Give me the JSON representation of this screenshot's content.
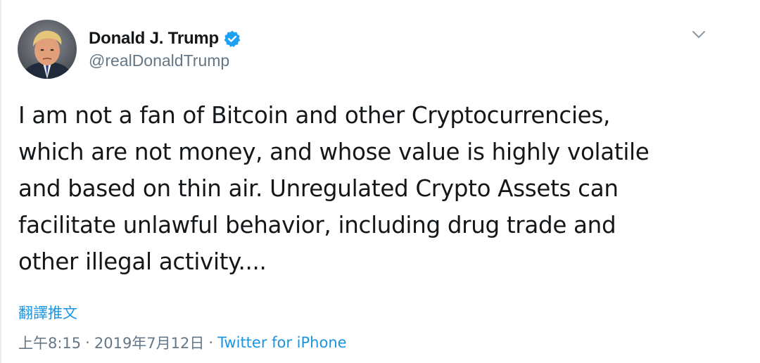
{
  "tweet": {
    "display_name": "Donald J. Trump",
    "handle": "@realDonaldTrump",
    "verified": true,
    "text": "I am not a fan of Bitcoin and other Cryptocurrencies,\nwhich are not money, and whose value is highly volatile\nand based on thin air. Unregulated Crypto Assets can\nfacilitate unlawful behavior, including drug trade and\nother illegal activity....",
    "translate_label": "翻譯推文",
    "time": "上午8:15",
    "separator": "·",
    "date": "2019年7月12日",
    "source": "Twitter for iPhone"
  },
  "colors": {
    "link": "#1b95e0",
    "muted": "#657786",
    "verified_badge": "#1da1f2",
    "text": "#14171a"
  },
  "icons": {
    "verified": "verified-badge-icon",
    "caret": "chevron-down-icon",
    "avatar": "profile-avatar"
  }
}
